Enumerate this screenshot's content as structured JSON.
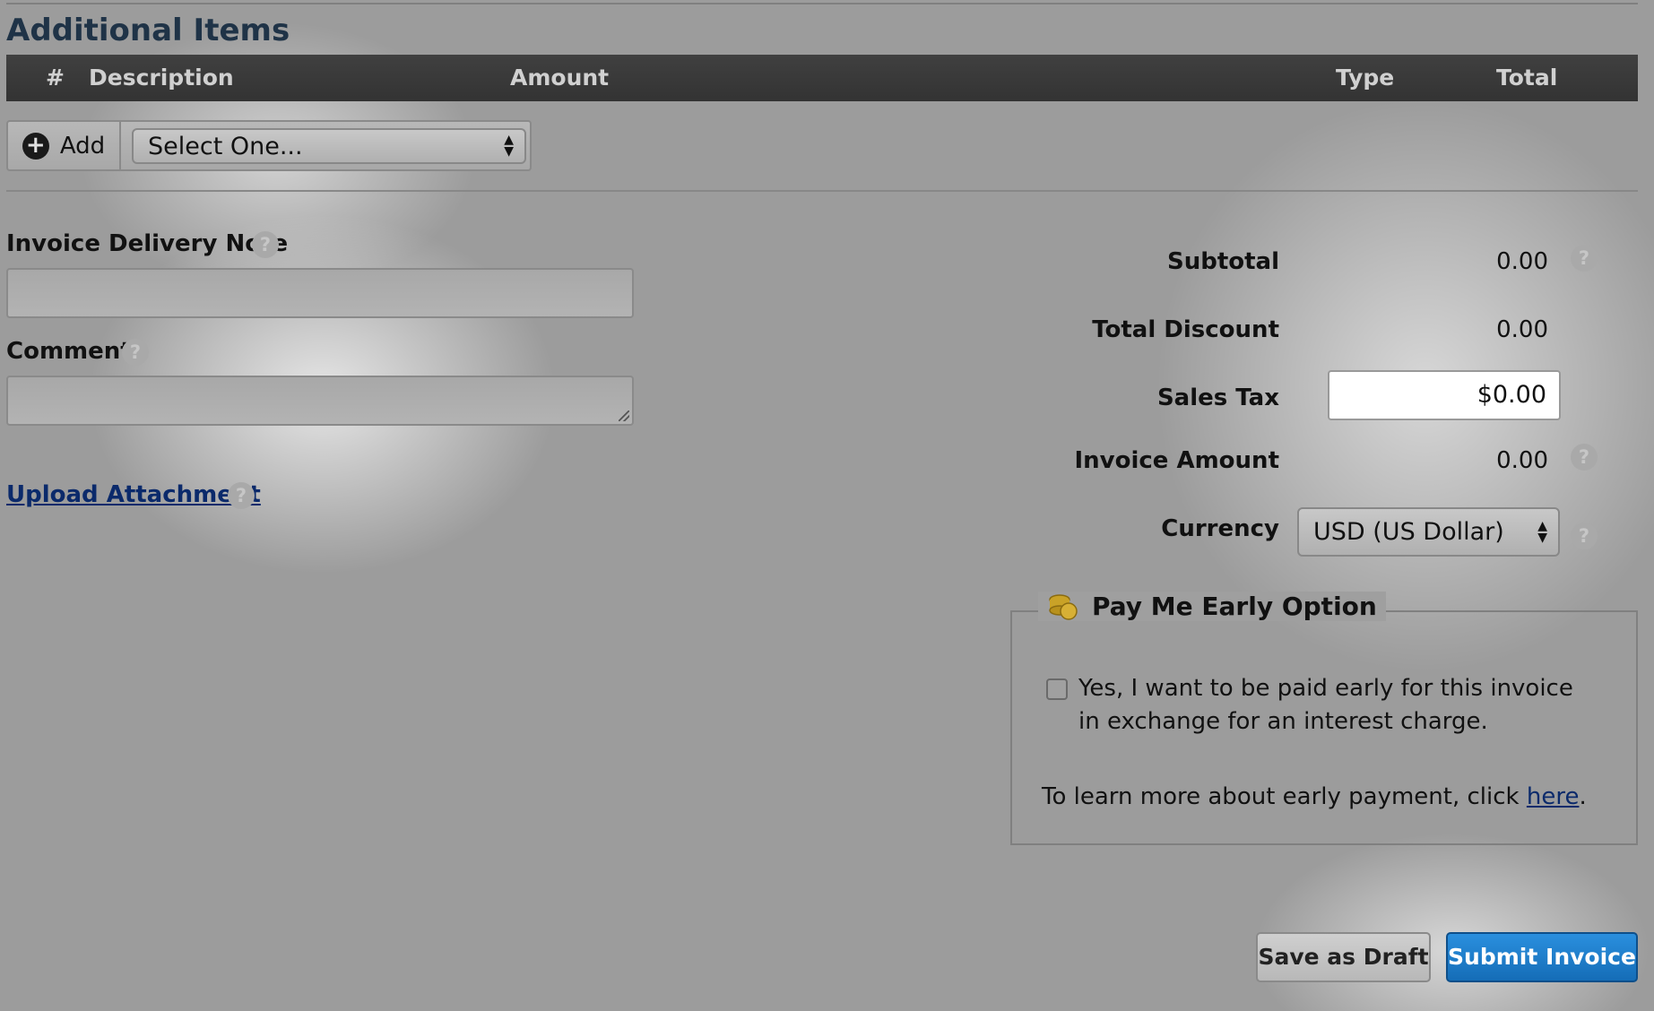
{
  "section": {
    "title": "Additional Items"
  },
  "table_header": {
    "num": "#",
    "description": "Description",
    "amount": "Amount",
    "type": "Type",
    "total": "Total"
  },
  "add_row": {
    "add_label": "Add",
    "select_value": "Select One..."
  },
  "delivery_note": {
    "label": "Invoice Delivery Note",
    "value": ""
  },
  "comment": {
    "label": "Comment",
    "value": ""
  },
  "upload": {
    "label": "Upload Attachment"
  },
  "summary": {
    "subtotal_label": "Subtotal",
    "subtotal_value": "0.00",
    "discount_label": "Total Discount",
    "discount_value": "0.00",
    "tax_label": "Sales Tax",
    "tax_value": "$0.00",
    "amount_label": "Invoice Amount",
    "amount_value": "0.00",
    "currency_label": "Currency",
    "currency_value": "USD (US Dollar)"
  },
  "early": {
    "legend": "Pay Me Early Option",
    "checkbox_text": "Yes, I want to be paid early for this invoice in exchange for an interest charge.",
    "checked": false,
    "learn_prefix": "To learn more about early payment, click ",
    "learn_link": "here",
    "learn_suffix": "."
  },
  "help_glyph": "?",
  "actions": {
    "draft": "Save as Draft",
    "submit": "Submit Invoice"
  },
  "colors": {
    "title": "#1f3347",
    "submit": "#1b7fd0",
    "link": "#0b2a6b"
  },
  "icons": {
    "add": "plus-circle-icon",
    "help": "question-icon",
    "coins": "coins-icon"
  }
}
